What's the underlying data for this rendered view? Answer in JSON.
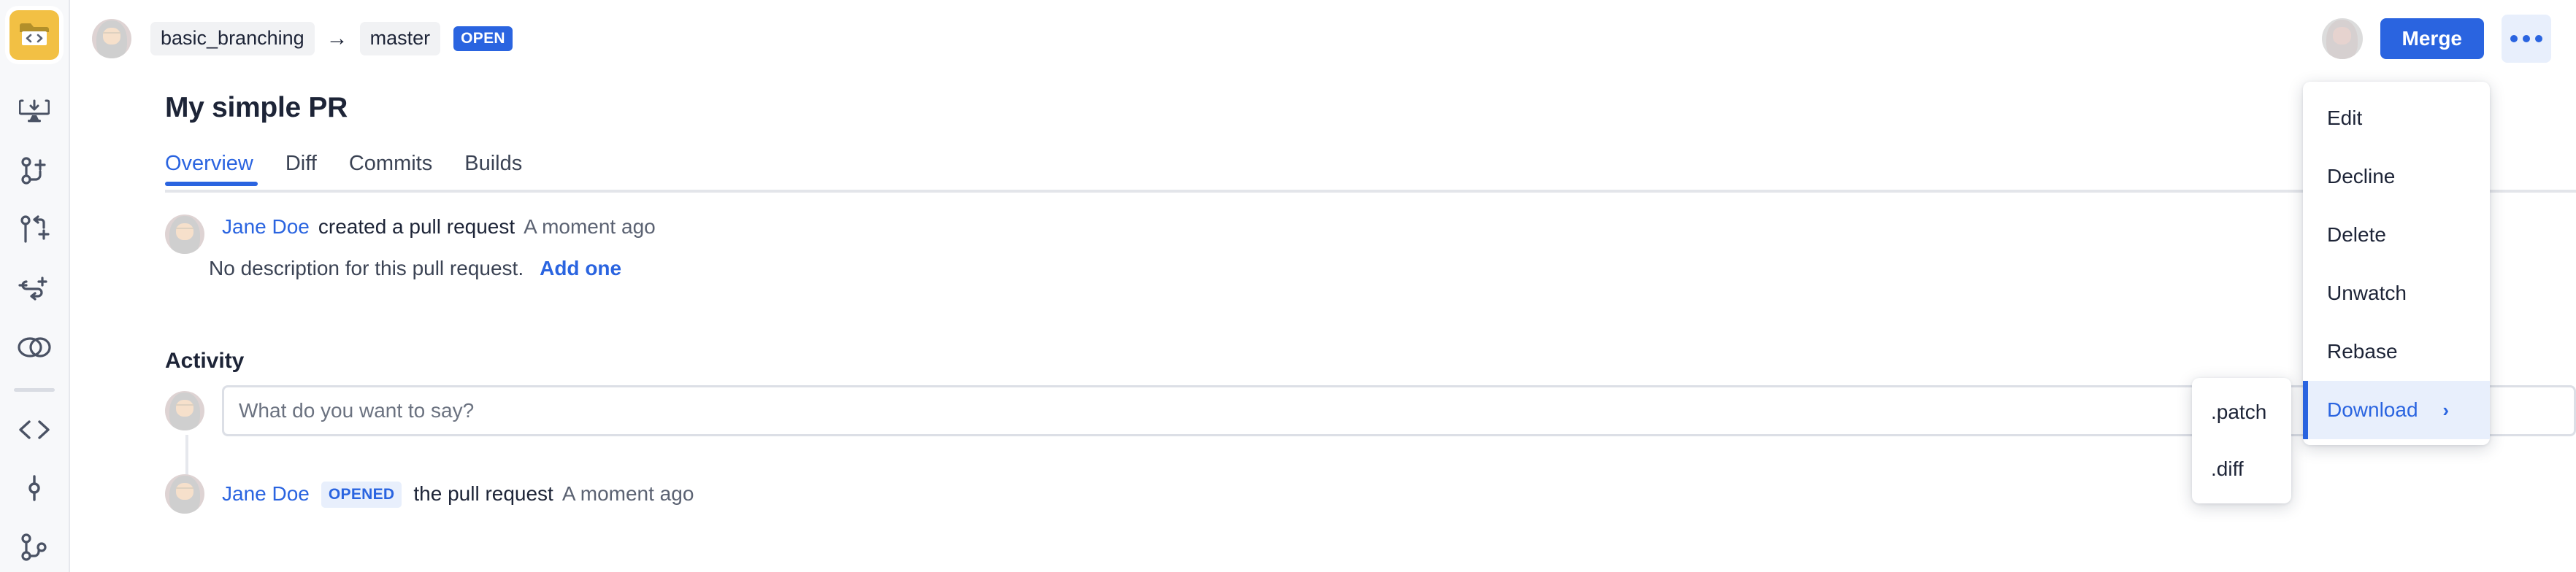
{
  "rail": {
    "items": [
      {
        "name": "project-folder-code-icon",
        "label": "Project"
      },
      {
        "name": "clone-download-icon",
        "label": "Clone"
      },
      {
        "name": "create-branch-icon",
        "label": "Create branch"
      },
      {
        "name": "pull-request-icon",
        "label": "Create pull request"
      },
      {
        "name": "commit-arrow-icon",
        "label": "Commit"
      },
      {
        "name": "merge-circles-icon",
        "label": "Merge"
      },
      {
        "name": "source-code-icon",
        "label": "Source"
      },
      {
        "name": "commit-node-icon",
        "label": "Commits"
      },
      {
        "name": "branches-icon",
        "label": "Branches"
      }
    ]
  },
  "header": {
    "source_branch": "basic_branching",
    "arrow": "→",
    "target_branch": "master",
    "status": "OPEN",
    "merge_label": "Merge",
    "more_label": "More actions"
  },
  "page": {
    "title": "My simple PR"
  },
  "tabs": [
    {
      "label": "Overview",
      "active": true
    },
    {
      "label": "Diff",
      "active": false
    },
    {
      "label": "Commits",
      "active": false
    },
    {
      "label": "Builds",
      "active": false
    }
  ],
  "created_event": {
    "user": "Jane Doe",
    "action": "created a pull request",
    "time": "A moment ago"
  },
  "description": {
    "empty_text": "No description for this pull request.",
    "add_link": "Add one"
  },
  "activity": {
    "heading": "Activity",
    "composer_placeholder": "What do you want to say?",
    "composer_value": ""
  },
  "opened_event": {
    "user": "Jane Doe",
    "badge": "OPENED",
    "action": "the pull request",
    "time": "A moment ago"
  },
  "more_menu": {
    "items": [
      {
        "label": "Edit",
        "highlighted": false,
        "has_submenu": false
      },
      {
        "label": "Decline",
        "highlighted": false,
        "has_submenu": false
      },
      {
        "label": "Delete",
        "highlighted": false,
        "has_submenu": false
      },
      {
        "label": "Unwatch",
        "highlighted": false,
        "has_submenu": false
      },
      {
        "label": "Rebase",
        "highlighted": false,
        "has_submenu": false
      },
      {
        "label": "Download",
        "highlighted": true,
        "has_submenu": true,
        "chevron": "›"
      }
    ]
  },
  "download_submenu": {
    "items": [
      {
        "label": ".patch"
      },
      {
        "label": ".diff"
      }
    ]
  },
  "colors": {
    "accent": "#2a64e0",
    "accent_soft": "#e8effc",
    "text": "#1d2437",
    "muted": "#5b6272",
    "rail_bg": "#f7f8fa",
    "project_yellow": "#f2c044",
    "pill_bg": "#f1f2f4",
    "border": "#dcdfe6"
  }
}
